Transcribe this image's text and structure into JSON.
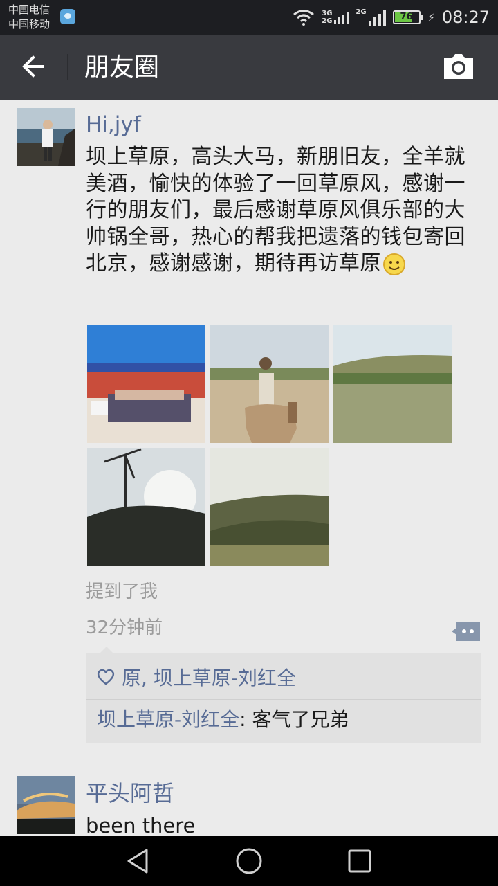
{
  "status_bar": {
    "carrier_1": "中国电信",
    "carrier_2": "中国移动",
    "network_1": "3G",
    "network_2": "2G",
    "network_3": "2G",
    "battery_level": "76",
    "time": "08:27"
  },
  "title_bar": {
    "title": "朋友圈",
    "back_icon": "arrow-left-icon",
    "camera_icon": "camera-icon"
  },
  "post": {
    "author": "Hi,jyf",
    "text": "坝上草原，高头大马，新朋旧友，全羊就美酒，愉快的体验了一回草原风，感谢一行的朋友们，最后感谢草原风俱乐部的大帅锅全哥，热心的帮我把遗落的钱包寄回北京，感谢感谢，期待再访草原",
    "photo_count": 5,
    "mention": "提到了我",
    "time": "32分钟前",
    "likes": "原, 坝上草原-刘红全",
    "comment_author": "坝上草原-刘红全",
    "comment_separator": ": ",
    "comment_text": "客气了兄弟"
  },
  "post2": {
    "author": "平头阿哲",
    "text": "been there"
  },
  "nav_bar": {
    "back_icon": "triangle-back-icon",
    "home_icon": "circle-home-icon",
    "recents_icon": "square-recents-icon"
  },
  "colors": {
    "status_bar": "#1d1e22",
    "title_bar": "#393a3f",
    "link_blue": "#576b95",
    "background": "#ebebeb",
    "battery_green": "#6cc644"
  }
}
